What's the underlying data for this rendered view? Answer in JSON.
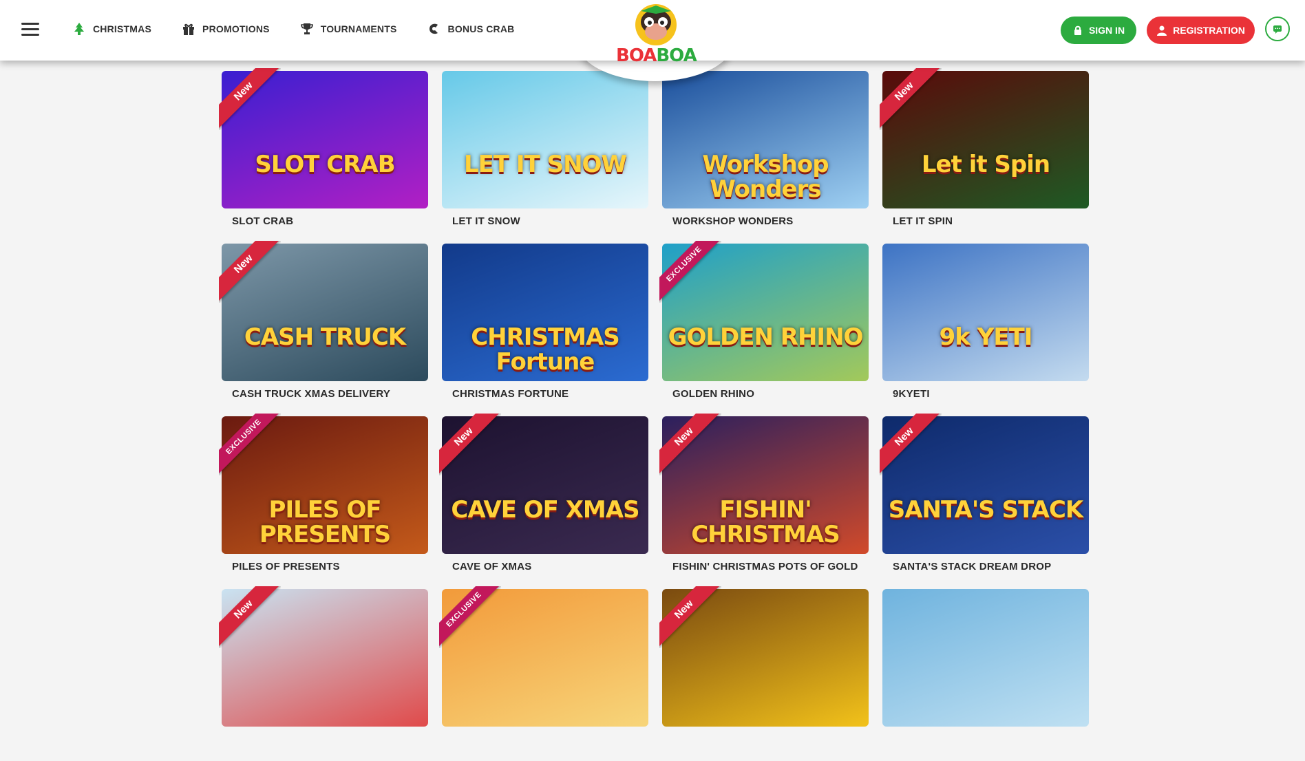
{
  "header": {
    "nav": [
      {
        "label": "CHRISTMAS",
        "icon": "tree-icon"
      },
      {
        "label": "PROMOTIONS",
        "icon": "gift-icon"
      },
      {
        "label": "TOURNAMENTS",
        "icon": "trophy-icon"
      },
      {
        "label": "BONUS CRAB",
        "icon": "crab-claw-icon"
      }
    ],
    "logo_text": "BOABOA",
    "sign_in": "SIGN IN",
    "registration": "REGISTRATION"
  },
  "colors": {
    "green": "#2cab3f",
    "red": "#ea3238",
    "badge_new": "#d7263d",
    "badge_exclusive": "#c2185b"
  },
  "badges": {
    "new": "New",
    "exclusive": "EXCLUSIVE"
  },
  "games": [
    {
      "name": "SLOT CRAB",
      "badge": "new",
      "art_title": "SLOT CRAB",
      "bg": [
        "#3a1fd1",
        "#b21fc4"
      ]
    },
    {
      "name": "LET IT SNOW",
      "badge": "",
      "art_title": "LET IT SNOW",
      "bg": [
        "#66c9e8",
        "#e7f6fb"
      ]
    },
    {
      "name": "WORKSHOP WONDERS",
      "badge": "",
      "art_title": "Workshop Wonders",
      "bg": [
        "#1b4f9c",
        "#9fd0f2"
      ]
    },
    {
      "name": "LET IT SPIN",
      "badge": "new",
      "art_title": "Let it Spin",
      "bg": [
        "#5a0a0a",
        "#1e5a24"
      ]
    },
    {
      "name": "CASH TRUCK XMAS DELIVERY",
      "badge": "new",
      "art_title": "CASH TRUCK",
      "bg": [
        "#7d97a8",
        "#2c4a5c"
      ]
    },
    {
      "name": "CHRISTMAS FORTUNE",
      "badge": "",
      "art_title": "CHRISTMAS Fortune",
      "bg": [
        "#123a8a",
        "#2b6bd1"
      ]
    },
    {
      "name": "GOLDEN RHINO",
      "badge": "exclusive",
      "art_title": "GOLDEN RHINO",
      "bg": [
        "#1fa0c9",
        "#a3c95a"
      ]
    },
    {
      "name": "9KYETI",
      "badge": "",
      "art_title": "9k YETI",
      "bg": [
        "#3d73c4",
        "#c4dbef"
      ]
    },
    {
      "name": "PILES OF PRESENTS",
      "badge": "exclusive",
      "art_title": "PILES OF PRESENTS",
      "bg": [
        "#6b1a10",
        "#c45a1a"
      ]
    },
    {
      "name": "CAVE OF XMAS",
      "badge": "new",
      "art_title": "CAVE OF XMAS",
      "bg": [
        "#1d1230",
        "#3a2a50"
      ]
    },
    {
      "name": "FISHIN' CHRISTMAS POTS OF GOLD",
      "badge": "new",
      "art_title": "FISHIN' CHRISTMAS",
      "bg": [
        "#2a1f5e",
        "#d14a2a"
      ]
    },
    {
      "name": "SANTA'S STACK DREAM DROP",
      "badge": "new",
      "art_title": "SANTA'S STACK",
      "bg": [
        "#0e2a6b",
        "#2b4fa8"
      ]
    },
    {
      "name": "",
      "badge": "new",
      "art_title": "",
      "bg": [
        "#c9e3f2",
        "#e04a4a"
      ]
    },
    {
      "name": "",
      "badge": "exclusive",
      "art_title": "",
      "bg": [
        "#f29a3a",
        "#f7d57a"
      ]
    },
    {
      "name": "",
      "badge": "new",
      "art_title": "",
      "bg": [
        "#7a4a10",
        "#f2c21a"
      ]
    },
    {
      "name": "",
      "badge": "",
      "art_title": "",
      "bg": [
        "#6fb3de",
        "#bfe0f2"
      ]
    }
  ]
}
